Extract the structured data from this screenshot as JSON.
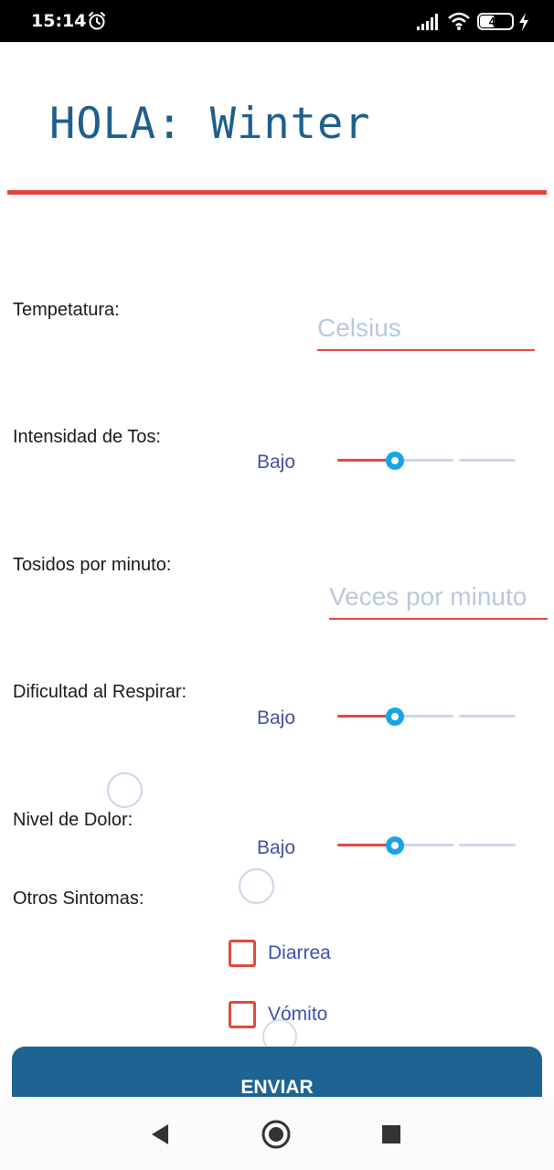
{
  "status_bar": {
    "time": "15:14",
    "battery": "45",
    "icons": [
      "alarm-icon",
      "signal-icon",
      "wifi-icon",
      "battery-icon",
      "charging-icon"
    ]
  },
  "header": {
    "greeting": "HOLA: Winter",
    "accent_color": "#e0483e",
    "title_color": "#1e5f8c"
  },
  "form": {
    "temperature": {
      "label": "Tempetatura:",
      "value": "",
      "placeholder": "Celsius"
    },
    "cough_intensity": {
      "label": "Intensidad de Tos:",
      "level_text": "Bajo",
      "slider_value_fraction": 0.33
    },
    "coughs_per_minute": {
      "label": "Tosidos por minuto:",
      "value": "",
      "placeholder": "Veces por minuto"
    },
    "breathing_difficulty": {
      "label": "Dificultad al Respirar:",
      "level_text": "Bajo",
      "slider_value_fraction": 0.33
    },
    "pain_level": {
      "label": "Nivel de Dolor:",
      "level_text": "Bajo",
      "slider_value_fraction": 0.33
    },
    "other_symptoms": {
      "label": "Otros Sintomas:",
      "options": [
        {
          "label": "Diarrea",
          "checked": false
        },
        {
          "label": "Vómito",
          "checked": false
        }
      ]
    },
    "submit_label": "ENVIAR",
    "slider_thumb_color": "#1aa3e8",
    "label_value_color": "#3f51a5",
    "button_color": "#1e6391"
  },
  "nav_bar": {
    "buttons": [
      "back-icon",
      "home-icon",
      "recents-icon"
    ]
  }
}
